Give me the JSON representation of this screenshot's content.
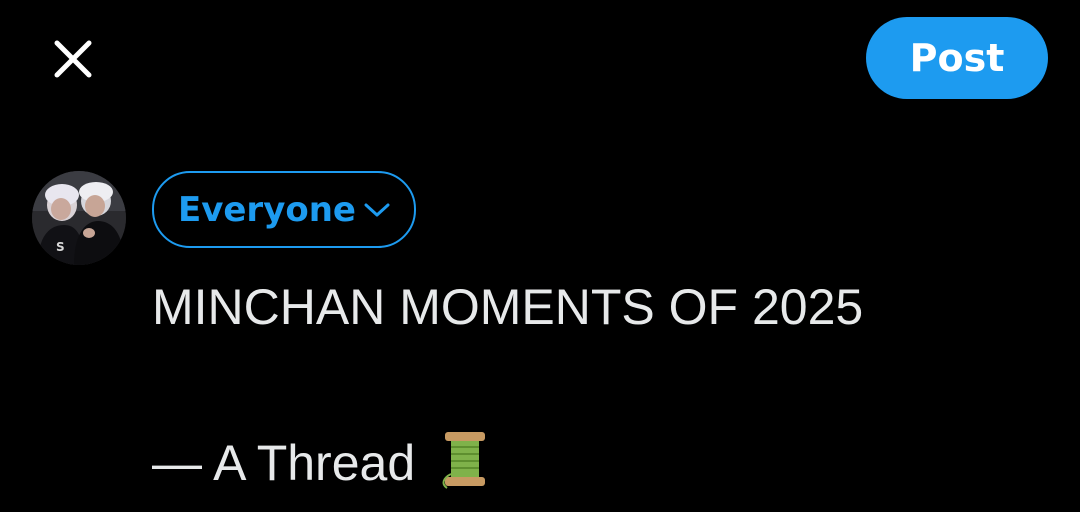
{
  "header": {
    "close_icon": "close-icon",
    "post_label": "Post",
    "post_color": "#1d9bf0"
  },
  "author": {
    "avatar_icon": "avatar-photo"
  },
  "audience": {
    "label": "Everyone",
    "icon": "chevron-down-icon"
  },
  "composer": {
    "line1": "MINCHAN MOMENTS OF 2025",
    "line2": "",
    "line3_text": "— A Thread",
    "line3_emoji_icon": "thread-spool-icon"
  }
}
